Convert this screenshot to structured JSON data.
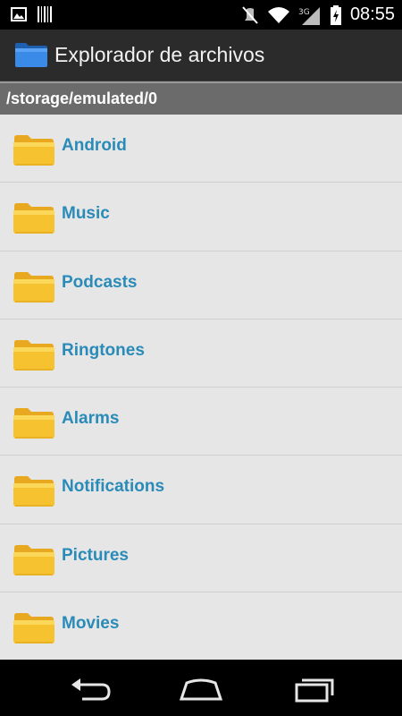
{
  "status_bar": {
    "time": "08:55",
    "left_icons": [
      "image-icon",
      "barcode-icon"
    ],
    "right_icons": [
      "mute-icon",
      "wifi-icon",
      "signal-3g-icon",
      "battery-charging-icon"
    ]
  },
  "action_bar": {
    "title": "Explorador de archivos",
    "icon": "folder-icon"
  },
  "path_bar": {
    "path": "/storage/emulated/0"
  },
  "files": [
    {
      "name": "Android"
    },
    {
      "name": "Music"
    },
    {
      "name": "Podcasts"
    },
    {
      "name": "Ringtones"
    },
    {
      "name": "Alarms"
    },
    {
      "name": "Notifications"
    },
    {
      "name": "Pictures"
    },
    {
      "name": "Movies"
    }
  ],
  "colors": {
    "folder": "#f6c22f",
    "file_name": "#2a8bb8",
    "list_bg": "#e6e6e6",
    "action_bar": "#2b2b2b",
    "path_bar": "#6b6b6b"
  },
  "nav_bar": [
    "back-icon",
    "home-icon",
    "recent-apps-icon"
  ]
}
